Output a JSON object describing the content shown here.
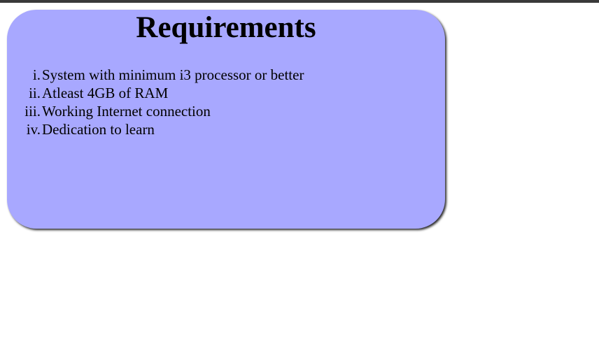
{
  "card": {
    "title": "Requirements",
    "background": "#a8a8ff",
    "items": [
      {
        "marker": "i.",
        "text": "System with minimum i3 processor or better"
      },
      {
        "marker": "ii.",
        "text": "Atleast 4GB of RAM"
      },
      {
        "marker": "iii.",
        "text": "Working Internet connection"
      },
      {
        "marker": "iv.",
        "text": "Dedication to learn"
      }
    ]
  }
}
